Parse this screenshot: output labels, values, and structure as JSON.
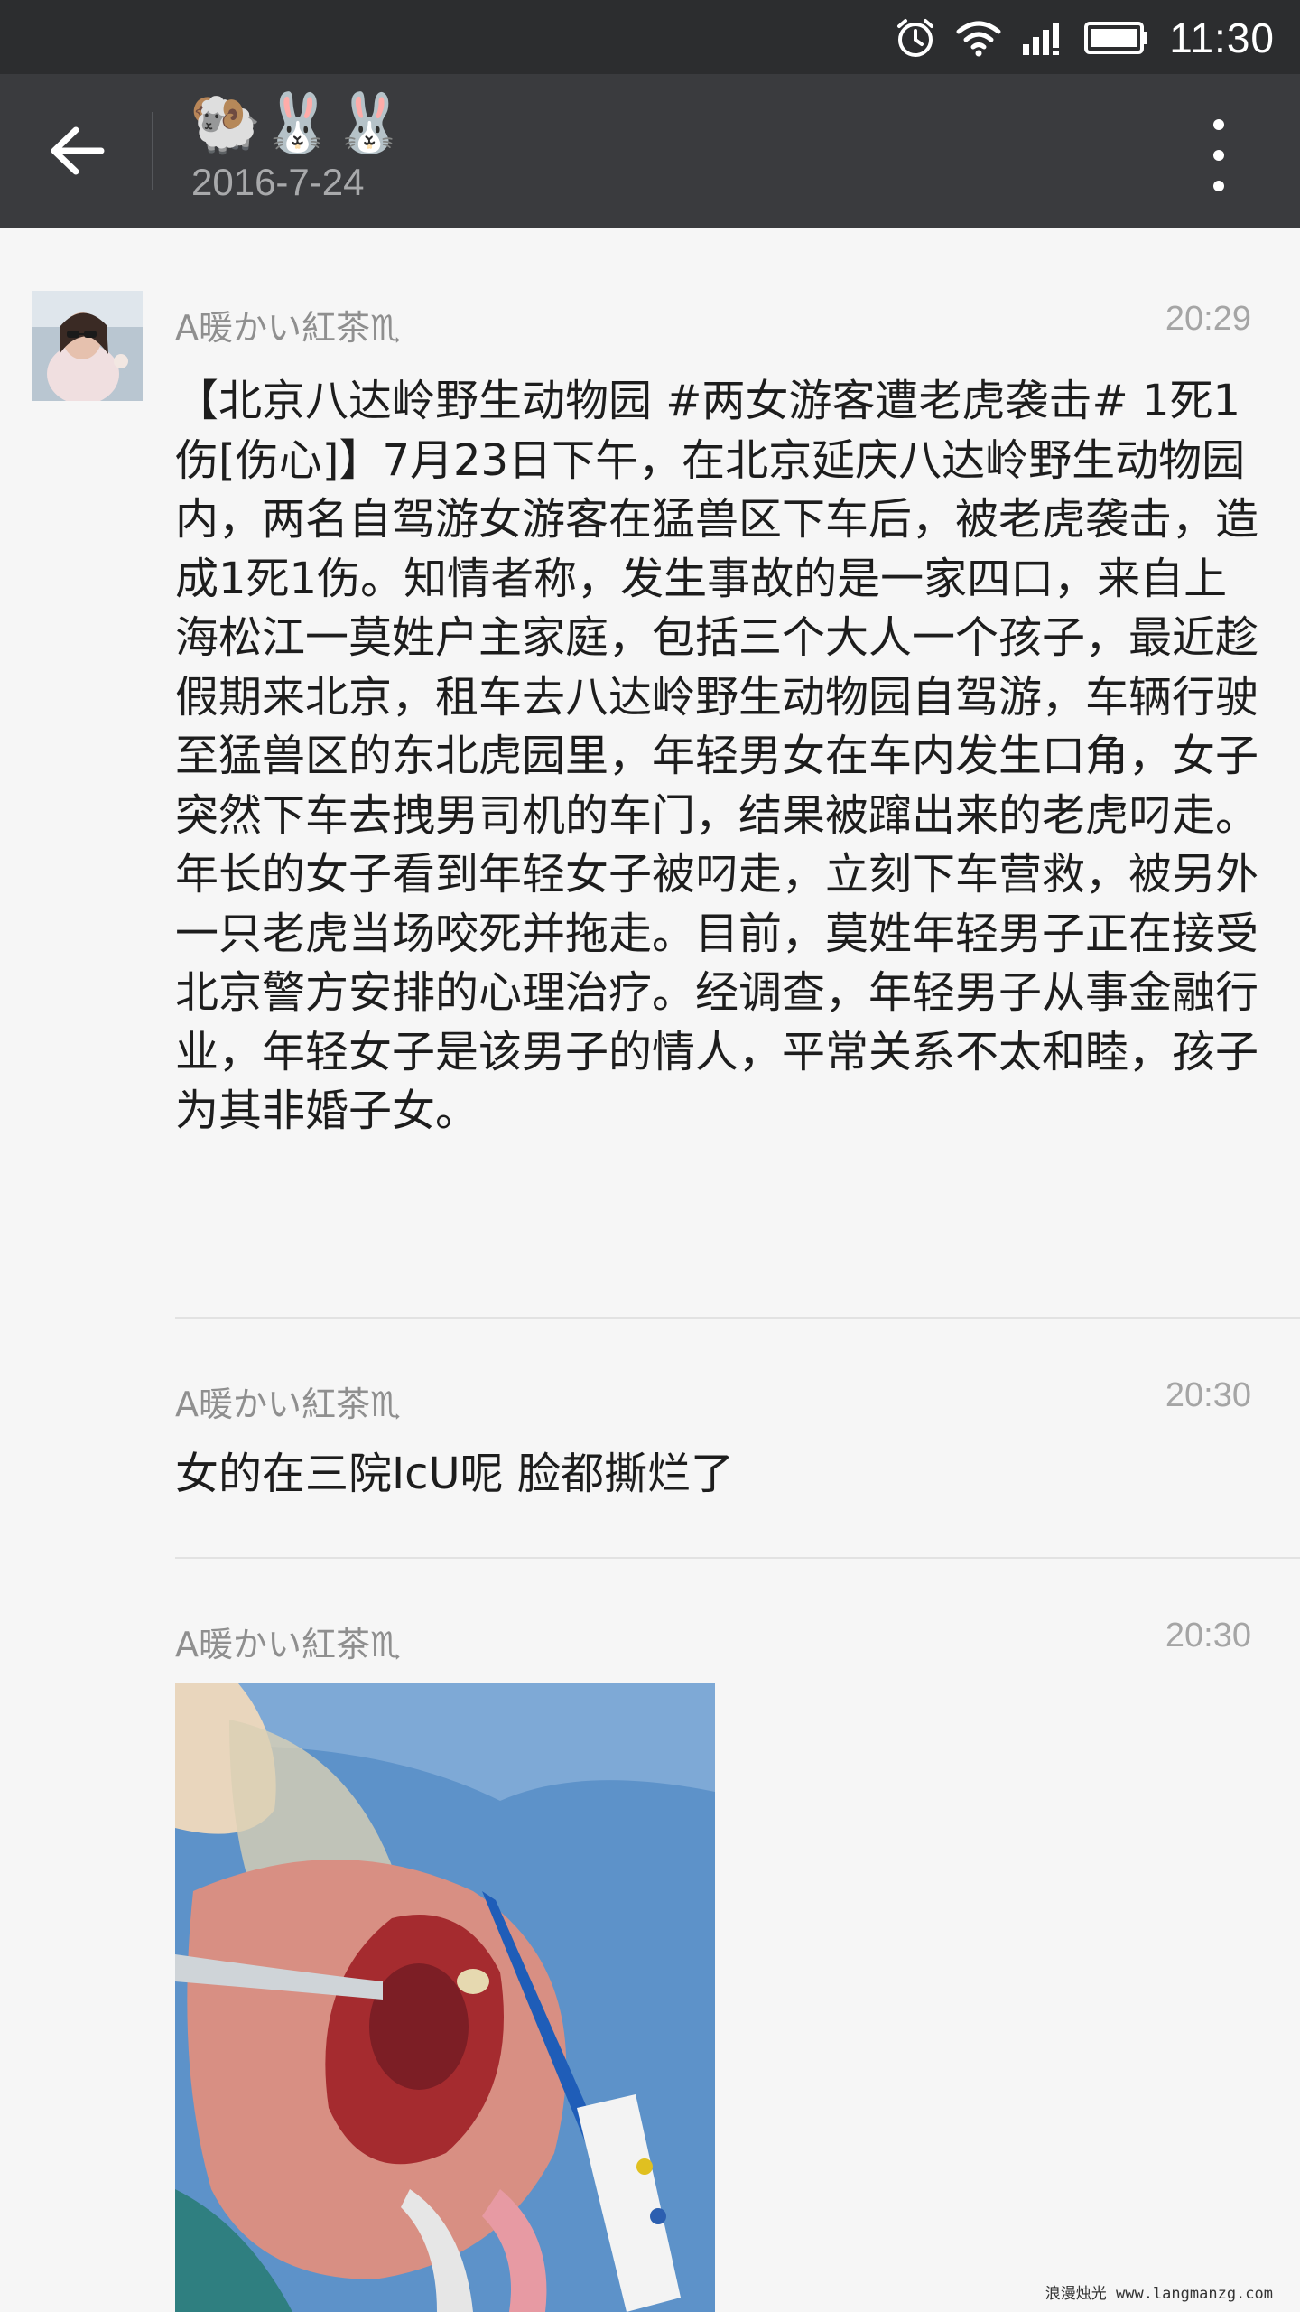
{
  "status_bar": {
    "time": "11:30",
    "icons": [
      "alarm-icon",
      "wifi-icon",
      "signal-icon",
      "battery-icon"
    ]
  },
  "header": {
    "title": "🐏🐰🐰",
    "subtitle": "2016-7-24"
  },
  "messages": [
    {
      "sender": "A暖かい紅茶♏",
      "time": "20:29",
      "text": "【北京八达岭野生动物园 #两女游客遭老虎袭击# 1死1伤[伤心]】7月23日下午，在北京延庆八达岭野生动物园内，两名自驾游女游客在猛兽区下车后，被老虎袭击，造成1死1伤。知情者称，发生事故的是一家四口，来自上海松江一莫姓户主家庭，包括三个大人一个孩子，最近趁假期来北京，租车去八达岭野生动物园自驾游，车辆行驶至猛兽区的东北虎园里，年轻男女在车内发生口角，女子突然下车去拽男司机的车门，结果被蹿出来的老虎叼走。年长的女子看到年轻女子被叼走，立刻下车营救，被另外一只老虎当场咬死并拖走。目前，莫姓年轻男子正在接受北京警方安排的心理治疗。经调查，年轻男子从事金融行业，年轻女子是该男子的情人，平常关系不太和睦，孩子为其非婚子女。"
    },
    {
      "sender": "A暖かい紅茶♏",
      "time": "20:30",
      "text": "女的在三院IcU呢 脸都撕烂了"
    },
    {
      "sender": "A暖かい紅茶♏",
      "time": "20:30",
      "image": "surgical-photo"
    }
  ],
  "watermark": "浪漫烛光 www.langmanzg.com",
  "colors": {
    "status_bar_bg": "#2c2d2f",
    "app_bar_bg": "#3a3b3e",
    "feed_bg": "#f6f6f6"
  }
}
